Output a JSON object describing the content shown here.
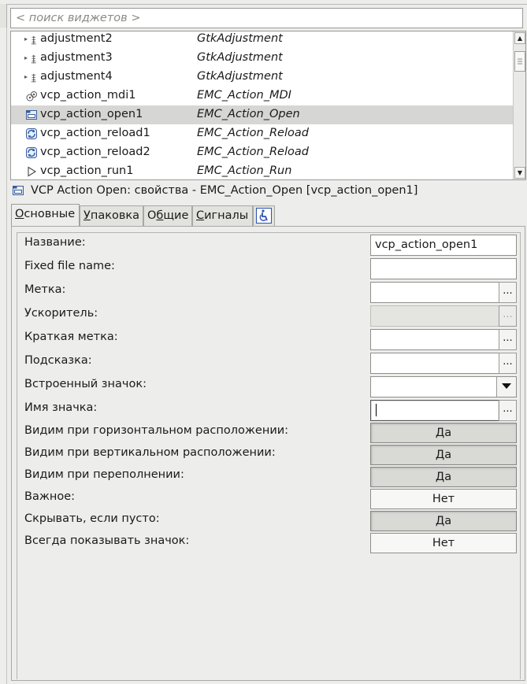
{
  "search": {
    "placeholder": "< поиск виджетов >"
  },
  "tree": {
    "rows": [
      {
        "name": "adjustment2",
        "type": "GtkAdjustment",
        "icon": "adjustment-icon",
        "expander": true
      },
      {
        "name": "adjustment3",
        "type": "GtkAdjustment",
        "icon": "adjustment-icon",
        "expander": true
      },
      {
        "name": "adjustment4",
        "type": "GtkAdjustment",
        "icon": "adjustment-icon",
        "expander": true
      },
      {
        "name": "vcp_action_mdi1",
        "type": "EMC_Action_MDI",
        "icon": "mdi-icon"
      },
      {
        "name": "vcp_action_open1",
        "type": "EMC_Action_Open",
        "icon": "open-file-icon",
        "selected": true
      },
      {
        "name": "vcp_action_reload1",
        "type": "EMC_Action_Reload",
        "icon": "reload-icon"
      },
      {
        "name": "vcp_action_reload2",
        "type": "EMC_Action_Reload",
        "icon": "reload-icon"
      },
      {
        "name": "vcp_action_run1",
        "type": "EMC_Action_Run",
        "icon": "run-icon"
      }
    ]
  },
  "properties": {
    "title": "VCP Action Open: свойства - EMC_Action_Open [vcp_action_open1]",
    "tabs": [
      {
        "pre": "",
        "key": "О",
        "post": "сновные",
        "active": true
      },
      {
        "pre": "",
        "key": "У",
        "post": "паковка"
      },
      {
        "pre": "О",
        "key": "б",
        "post": "щие"
      },
      {
        "pre": "",
        "key": "С",
        "post": "игналы"
      }
    ],
    "accessibility_tab_icon": "accessibility-icon",
    "rows": [
      {
        "label": "Название:",
        "kind": "text",
        "value": "vcp_action_open1"
      },
      {
        "label": "Fixed file name:",
        "kind": "text",
        "value": ""
      },
      {
        "label": "Метка:",
        "kind": "text-dots",
        "value": "",
        "dots": "..."
      },
      {
        "label": "Ускоритель:",
        "kind": "text-dots-disabled",
        "value": "",
        "dots": "..."
      },
      {
        "label": "Краткая метка:",
        "kind": "text-dots",
        "value": "",
        "dots": "..."
      },
      {
        "label": "Подсказка:",
        "kind": "text-dots",
        "value": "",
        "dots": "..."
      },
      {
        "label": "Встроенный значок:",
        "kind": "combo",
        "value": ""
      },
      {
        "label": "Имя значка:",
        "kind": "text-dots-focus",
        "value": "",
        "dots": "..."
      },
      {
        "label": "Видим при горизонтальном расположении:",
        "kind": "toggle",
        "value": "Да",
        "on": true
      },
      {
        "label": "Видим при вертикальном расположении:",
        "kind": "toggle",
        "value": "Да",
        "on": true
      },
      {
        "label": "Видим при переполнении:",
        "kind": "toggle",
        "value": "Да",
        "on": true
      },
      {
        "label": "Важное:",
        "kind": "toggle",
        "value": "Нет",
        "on": false
      },
      {
        "label": "Скрывать, если пусто:",
        "kind": "toggle",
        "value": "Да",
        "on": true
      },
      {
        "label": "Всегда показывать значок:",
        "kind": "toggle",
        "value": "Нет",
        "on": false
      }
    ]
  }
}
